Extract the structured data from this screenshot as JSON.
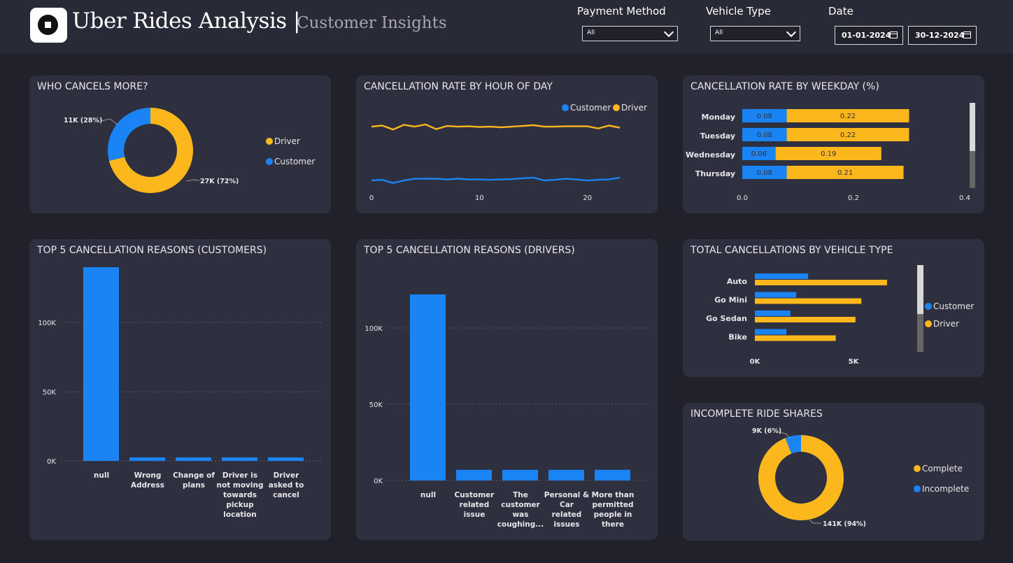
{
  "header": {
    "title": "Uber Rides Analysis |",
    "subtitle": "Customer Insights",
    "filters": {
      "payment_method": {
        "label": "Payment Method",
        "value": "All"
      },
      "vehicle_type": {
        "label": "Vehicle Type",
        "value": "All"
      },
      "date": {
        "label": "Date",
        "start": "01-01-2024",
        "end": "30-12-2024"
      }
    }
  },
  "colors": {
    "customer": "#1a84f5",
    "driver": "#fbb71b",
    "panel": "#2e303f",
    "background": "#20212b"
  },
  "panels": {
    "who_cancels": "WHO CANCELS MORE?",
    "hourly": "CANCELLATION RATE BY HOUR OF DAY",
    "weekday": "CANCELLATION RATE BY WEEKDAY (%)",
    "customer_reasons": "TOP 5 CANCELLATION REASONS (CUSTOMERS)",
    "driver_reasons": "TOP 5 CANCELLATION REASONS (DRIVERS)",
    "vehicle": "TOTAL CANCELLATIONS BY VEHICLE TYPE",
    "incomplete": "INCOMPLETE RIDE SHARES"
  },
  "chart_data": [
    {
      "id": "who_cancels",
      "type": "pie",
      "labels": [
        "Driver",
        "Customer"
      ],
      "values": [
        27,
        11
      ],
      "data_labels": [
        "27K (72%)",
        "11K (28%)"
      ],
      "legend": [
        "Driver",
        "Customer"
      ],
      "legend_position": "right"
    },
    {
      "id": "hourly",
      "type": "line",
      "x": [
        0,
        1,
        2,
        3,
        4,
        5,
        6,
        7,
        8,
        9,
        10,
        11,
        12,
        13,
        14,
        15,
        16,
        17,
        18,
        19,
        20,
        21,
        22,
        23
      ],
      "x_ticks": [
        "0",
        "10",
        "20"
      ],
      "xlim": [
        0,
        23
      ],
      "ylim": [
        0,
        0.3
      ],
      "grid": false,
      "legend": [
        "Customer",
        "Driver"
      ],
      "legend_position": "top-right",
      "series": [
        {
          "name": "Customer",
          "values": [
            0.07,
            0.072,
            0.063,
            0.07,
            0.075,
            0.075,
            0.075,
            0.073,
            0.075,
            0.073,
            0.073,
            0.072,
            0.073,
            0.074,
            0.076,
            0.078,
            0.07,
            0.072,
            0.075,
            0.073,
            0.07,
            0.072,
            0.073,
            0.078
          ]
        },
        {
          "name": "Driver",
          "values": [
            0.22,
            0.223,
            0.212,
            0.225,
            0.22,
            0.226,
            0.213,
            0.222,
            0.22,
            0.221,
            0.219,
            0.22,
            0.218,
            0.22,
            0.222,
            0.224,
            0.22,
            0.22,
            0.221,
            0.221,
            0.221,
            0.215,
            0.223,
            0.217
          ]
        }
      ]
    },
    {
      "id": "weekday",
      "type": "bar",
      "orientation": "horizontal",
      "stacked": true,
      "categories": [
        "Monday",
        "Tuesday",
        "Wednesday",
        "Thursday"
      ],
      "series": [
        {
          "name": "Customer",
          "values": [
            0.08,
            0.08,
            0.06,
            0.08
          ]
        },
        {
          "name": "Driver",
          "values": [
            0.22,
            0.22,
            0.19,
            0.21
          ]
        }
      ],
      "data_labels": [
        [
          "0.08",
          "0.08",
          "0.06",
          "0.08"
        ],
        [
          "0.22",
          "0.22",
          "0.19",
          "0.21"
        ]
      ],
      "x_ticks": [
        "0.0",
        "0.2",
        "0.4"
      ],
      "xlim": [
        0,
        0.4
      ]
    },
    {
      "id": "customer_reasons",
      "type": "bar",
      "categories": [
        "null",
        "Wrong Address",
        "Change of plans",
        "Driver is not moving towards pickup location",
        "Driver asked to cancel"
      ],
      "values": [
        140000,
        2500,
        2500,
        2500,
        2500
      ],
      "y_ticks": [
        "0K",
        "50K",
        "100K"
      ],
      "ylim": [
        0,
        140000
      ],
      "grid": true
    },
    {
      "id": "driver_reasons",
      "type": "bar",
      "categories": [
        "null",
        "Customer related issue",
        "The customer was coughing...",
        "Personal & Car related issues",
        "More than permitted people in there"
      ],
      "values": [
        122000,
        7000,
        7000,
        7000,
        7000
      ],
      "y_ticks": [
        "0K",
        "50K",
        "100K"
      ],
      "ylim": [
        0,
        122000
      ],
      "grid": true
    },
    {
      "id": "vehicle",
      "type": "bar",
      "orientation": "horizontal",
      "categories": [
        "Auto",
        "Go Mini",
        "Go Sedan",
        "Bike"
      ],
      "series": [
        {
          "name": "Customer",
          "values": [
            2700,
            2100,
            1800,
            1600
          ]
        },
        {
          "name": "Driver",
          "values": [
            6700,
            5400,
            5100,
            4100
          ]
        }
      ],
      "x_ticks": [
        "0K",
        "5K"
      ],
      "legend": [
        "Customer",
        "Driver"
      ],
      "legend_position": "right"
    },
    {
      "id": "incomplete",
      "type": "pie",
      "labels": [
        "Complete",
        "Incomplete"
      ],
      "values": [
        141,
        9
      ],
      "data_labels": [
        "141K (94%)",
        "9K (6%)"
      ],
      "legend": [
        "Complete",
        "Incomplete"
      ],
      "legend_position": "right"
    }
  ]
}
